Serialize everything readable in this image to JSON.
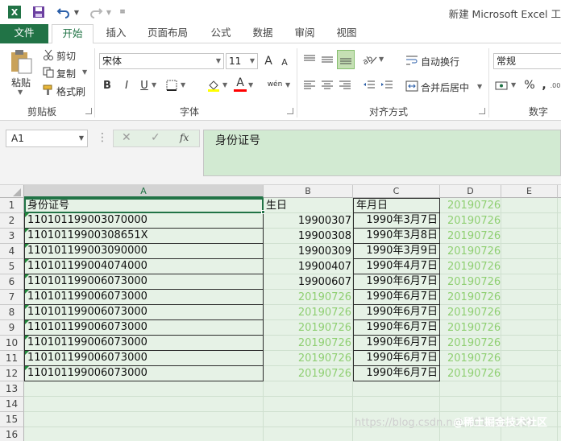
{
  "title_bar": {
    "title": "新建 Microsoft Excel 工",
    "icons": [
      "excel-logo-icon",
      "save-icon",
      "undo-icon",
      "redo-icon",
      "customize-qa-icon"
    ]
  },
  "tabs": [
    {
      "label": "文件"
    },
    {
      "label": "开始"
    },
    {
      "label": "插入"
    },
    {
      "label": "页面布局"
    },
    {
      "label": "公式"
    },
    {
      "label": "数据"
    },
    {
      "label": "审阅"
    },
    {
      "label": "视图"
    }
  ],
  "ribbon": {
    "clipboard": {
      "paste": "粘贴",
      "cut": "剪切",
      "copy": "复制",
      "format_painter": "格式刷",
      "group": "剪贴板"
    },
    "font": {
      "name": "宋体",
      "size": "11",
      "bold": "B",
      "italic": "I",
      "underline": "U",
      "grow": "A",
      "shrink": "A",
      "font_color": "A",
      "wen": "wén",
      "group": "字体"
    },
    "alignment": {
      "wrap_text": "自动换行",
      "merge_center": "合并后居中",
      "group": "对齐方式"
    },
    "number": {
      "format": "常规",
      "percent": "%",
      "comma": ",",
      "group": "数字"
    }
  },
  "formula_bar": {
    "name_box": "A1",
    "cancel": "✕",
    "enter": "✓",
    "fx": "fx",
    "content": "身份证号"
  },
  "sheet": {
    "columns": [
      "A",
      "B",
      "C",
      "D",
      "E"
    ],
    "row_numbers": [
      "1",
      "2",
      "3",
      "4",
      "5",
      "6",
      "7",
      "8",
      "9",
      "10",
      "11",
      "12",
      "13",
      "14",
      "15",
      "16"
    ],
    "rows": [
      {
        "a": "身份证号",
        "b": "生日",
        "c": "年月日",
        "d": "20190726"
      },
      {
        "a": "110101199003070000",
        "b": "19900307",
        "c": "1990年3月7日",
        "d": "20190726"
      },
      {
        "a": "11010119900308651X",
        "b": "19900308",
        "c": "1990年3月8日",
        "d": "20190726"
      },
      {
        "a": "110101199003090000",
        "b": "19900309",
        "c": "1990年3月9日",
        "d": "20190726"
      },
      {
        "a": "110101199004074000",
        "b": "19900407",
        "c": "1990年4月7日",
        "d": "20190726"
      },
      {
        "a": "110101199006073000",
        "b": "19900607",
        "c": "1990年6月7日",
        "d": "20190726"
      },
      {
        "a": "110101199006073000",
        "b": "20190726",
        "c": "1990年6月7日",
        "d": "20190726"
      },
      {
        "a": "110101199006073000",
        "b": "20190726",
        "c": "1990年6月7日",
        "d": "20190726"
      },
      {
        "a": "110101199006073000",
        "b": "20190726",
        "c": "1990年6月7日",
        "d": "20190726"
      },
      {
        "a": "110101199006073000",
        "b": "20190726",
        "c": "1990年6月7日",
        "d": "20190726"
      },
      {
        "a": "110101199006073000",
        "b": "20190726",
        "c": "1990年6月7日",
        "d": "20190726"
      },
      {
        "a": "110101199006073000",
        "b": "20190726",
        "c": "1990年6月7日",
        "d": "20190726"
      }
    ]
  },
  "watermark": "https://blog.csdn.net/u013310169",
  "watermark2": "@稀土掘金技术社区",
  "colors": {
    "accent": "#217346",
    "grid_bg": "#e6f2e6",
    "light_green_text": "#8fcf72"
  }
}
